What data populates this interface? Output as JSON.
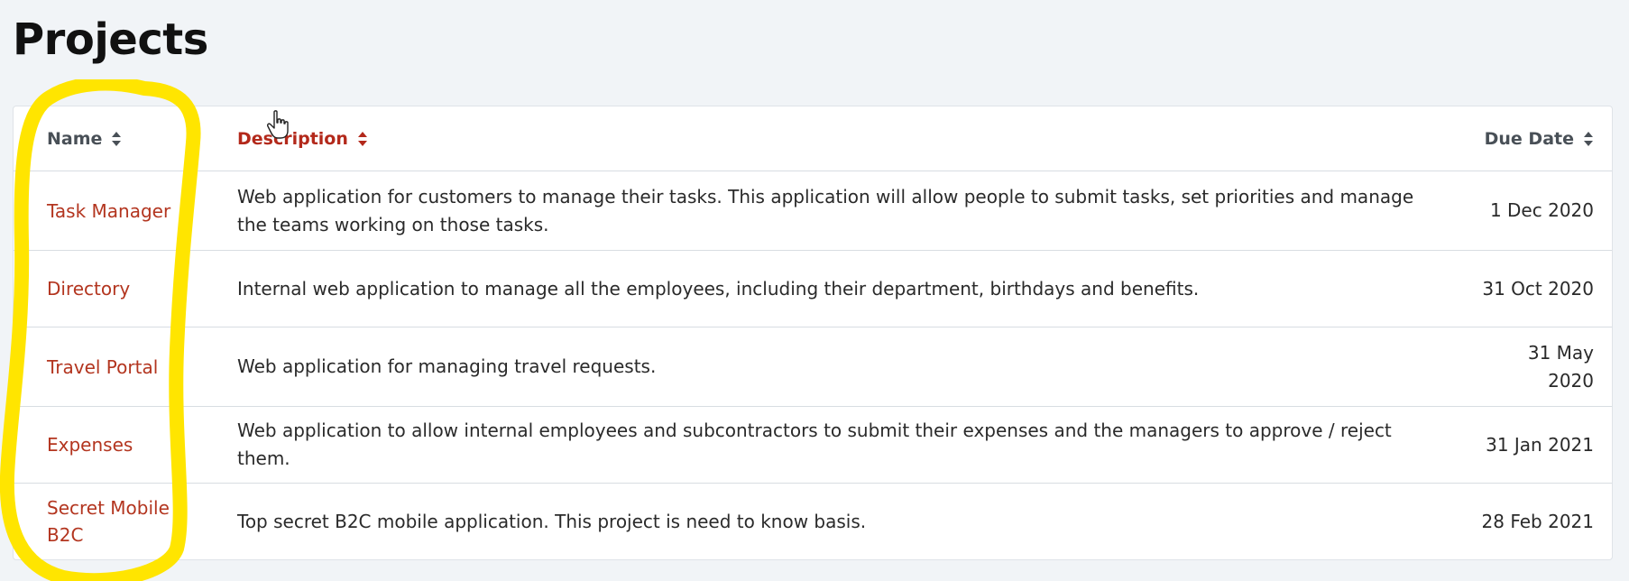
{
  "page": {
    "title": "Projects"
  },
  "table": {
    "columns": {
      "name": "Name",
      "description": "Description",
      "due_date": "Due Date"
    },
    "sort_icon": "sort-updown-icon",
    "active_sort_column": "description",
    "rows": [
      {
        "name": "Task Manager",
        "description": "Web application for customers to manage their tasks. This application will allow people to submit tasks, set priorities and manage the teams working on those tasks.",
        "due_date": "1 Dec 2020"
      },
      {
        "name": "Directory",
        "description": "Internal web application to manage all the employees, including their department, birthdays and benefits.",
        "due_date": "31 Oct 2020"
      },
      {
        "name": "Travel Portal",
        "description": "Web application for managing travel requests.",
        "due_date": "31 May 2020"
      },
      {
        "name": "Expenses",
        "description": "Web application to allow internal employees and subcontractors to submit their expenses and the managers to approve / reject them.",
        "due_date": "31 Jan 2021"
      },
      {
        "name": "Secret Mobile B2C",
        "description": "Top secret B2C mobile application. This project is need to know basis.",
        "due_date": "28 Feb 2021"
      }
    ]
  },
  "colors": {
    "background": "#f1f4f7",
    "link": "#b3351f",
    "active_header": "#b3291b",
    "header": "#495057",
    "highlight_annotation": "#ffe500"
  },
  "overlay": {
    "cursor_icon": "hand-pointer-icon",
    "annotation": "highlight-circle"
  }
}
